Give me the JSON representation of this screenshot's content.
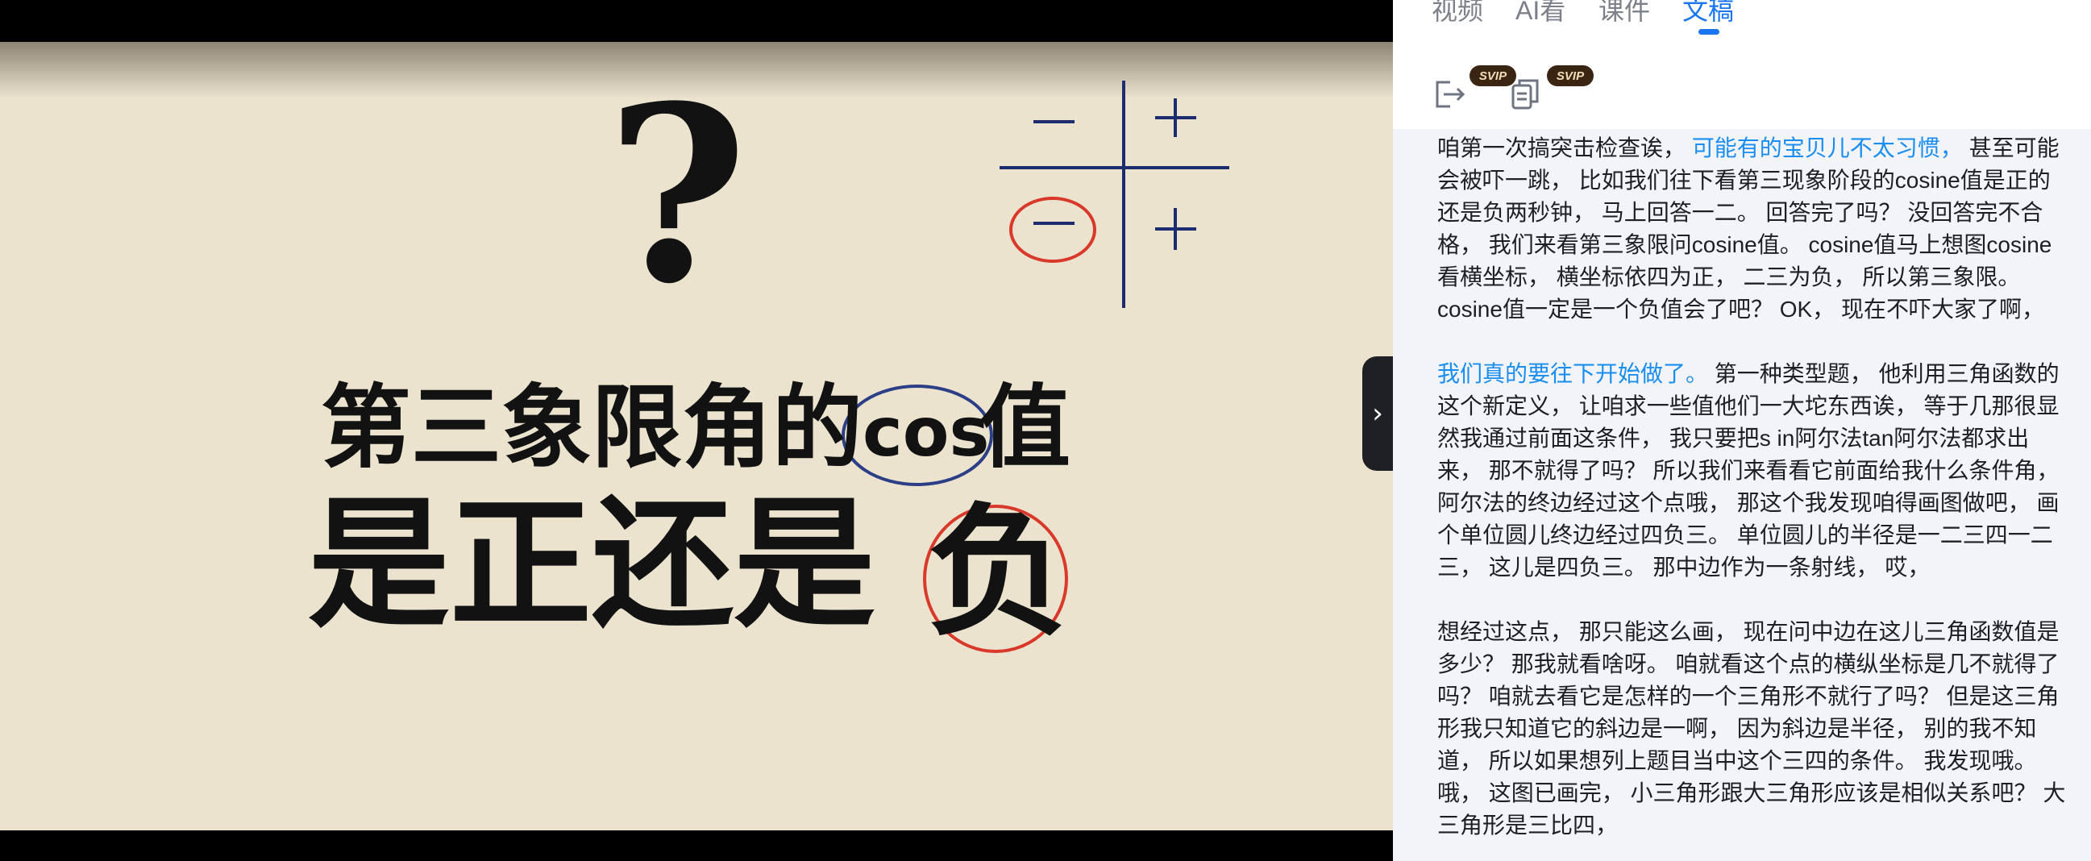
{
  "video": {
    "title_line1_prefix": "第三象限角的",
    "title_line1_cos": "cos",
    "title_line1_suffix": "值",
    "title_line2_prefix": "是正还是",
    "title_line2_highlight": "负",
    "question_mark": "?",
    "quadrant_signs": {
      "q2": "−",
      "q1": "+",
      "q3": "−",
      "q4": "+"
    },
    "circle_color": "#d8392b",
    "ellipse_color": "#2c3f86",
    "axis_color": "#1d2c6e"
  },
  "sidebar_toggle": {
    "icon": "chevron-right-icon",
    "label": "›"
  },
  "tabs": [
    {
      "label": "视频",
      "active": false
    },
    {
      "label": "AI看",
      "active": false
    },
    {
      "label": "课件",
      "active": false
    },
    {
      "label": "文稿",
      "active": true
    }
  ],
  "tools": [
    {
      "icon": "export-icon",
      "badge": "SVIP"
    },
    {
      "icon": "copy-document-icon",
      "badge": "SVIP"
    }
  ],
  "transcript": {
    "p1_pre": "咱第一次搞突击检查诶，",
    "p1_hl": "可能有的宝贝儿不太习惯，",
    "p1_post": "甚至可能会被吓一跳， 比如我们往下看第三现象阶段的cosine值是正的还是负两秒钟， 马上回答一二。 回答完了吗？ 没回答完不合格， 我们来看第三象限问cosine值。 cosine值马上想图cosine看横坐标， 横坐标依四为正， 二三为负， 所以第三象限。 cosine值一定是一个负值会了吧？ OK， 现在不吓大家了啊，",
    "p2_hl": "我们真的要往下开始做了。",
    "p2_post": "第一种类型题， 他利用三角函数的这个新定义， 让咱求一些值他们一大坨东西诶， 等于几那很显然我通过前面这条件， 我只要把s in阿尔法tan阿尔法都求出来， 那不就得了吗？ 所以我们来看看它前面给我什么条件角， 阿尔法的终边经过这个点哦， 那这个我发现咱得画图做吧， 画个单位圆儿终边经过四负三。 单位圆儿的半径是一二三四一二三， 这儿是四负三。 那中边作为一条射线， 哎，",
    "p3": "想经过这点， 那只能这么画， 现在问中边在这儿三角函数值是多少？ 那我就看啥呀。 咱就看这个点的横纵坐标是几不就得了吗？ 咱就去看它是怎样的一个三角形不就行了吗？ 但是这三角形我只知道它的斜边是一啊， 因为斜边是半径， 别的我不知道， 所以如果想列上题目当中这个三四的条件。 我发现哦。 哦， 这图已画完， 小三角形跟大三角形应该是相似关系吧？ 大三角形是三比四，"
  }
}
